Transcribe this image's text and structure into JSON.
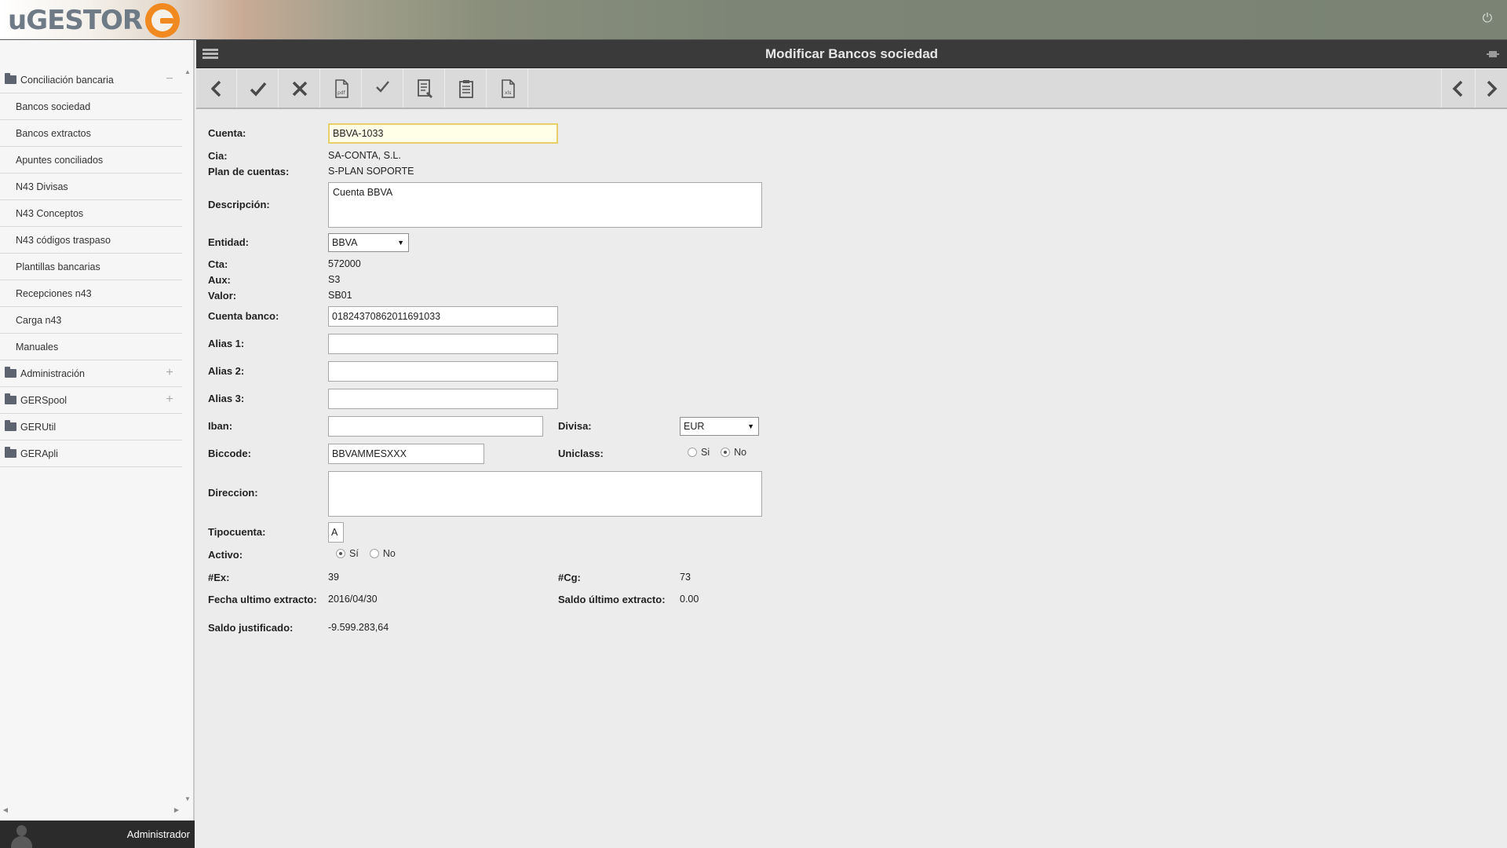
{
  "app": {
    "logo_text": "uGESTOR",
    "page_title": "Modificar Bancos sociedad",
    "user_name": "Administrador"
  },
  "sidebar": {
    "groups": [
      {
        "label": "Conciliación bancaria",
        "toggle": "−"
      },
      {
        "label": "Administración",
        "toggle": "+"
      },
      {
        "label": "GERSpool",
        "toggle": "+"
      },
      {
        "label": "GERUtil",
        "toggle": ""
      },
      {
        "label": "GERApli",
        "toggle": ""
      }
    ],
    "items": [
      "Bancos sociedad",
      "Bancos extractos",
      "Apuntes conciliados",
      "N43 Divisas",
      "N43 Conceptos",
      "N43 códigos traspaso",
      "Plantillas bancarias",
      "Recepciones n43",
      "Carga n43",
      "Manuales"
    ]
  },
  "toolbar": {
    "buttons": [
      "back",
      "accept",
      "cancel",
      "pdf",
      "check",
      "document",
      "clipboard",
      "xls"
    ],
    "nav": [
      "previous-record",
      "next-record"
    ]
  },
  "form": {
    "cuenta": {
      "label": "Cuenta:",
      "value": "BBVA-1033"
    },
    "cia": {
      "label": "Cia:",
      "value": "SA-CONTA, S.L."
    },
    "plan": {
      "label": "Plan de cuentas:",
      "value": "S-PLAN SOPORTE"
    },
    "descripcion": {
      "label": "Descripción:",
      "value": "Cuenta BBVA"
    },
    "entidad": {
      "label": "Entidad:",
      "value": "BBVA"
    },
    "cta": {
      "label": "Cta:",
      "value": "572000"
    },
    "aux": {
      "label": "Aux:",
      "value": "S3"
    },
    "valor": {
      "label": "Valor:",
      "value": "SB01"
    },
    "cuenta_banco": {
      "label": "Cuenta banco:",
      "value": "01824370862011691033"
    },
    "alias1": {
      "label": "Alias 1:",
      "value": ""
    },
    "alias2": {
      "label": "Alias 2:",
      "value": ""
    },
    "alias3": {
      "label": "Alias 3:",
      "value": ""
    },
    "iban": {
      "label": "Iban:",
      "value": ""
    },
    "divisa": {
      "label": "Divisa:",
      "value": "EUR"
    },
    "biccode": {
      "label": "Biccode:",
      "value": "BBVAMMESXXX"
    },
    "uniclass": {
      "label": "Uniclass:",
      "options": [
        "Si",
        "No"
      ],
      "selected": "No"
    },
    "direccion": {
      "label": "Direccion:",
      "value": ""
    },
    "tipocuenta": {
      "label": "Tipocuenta:",
      "value": "A"
    },
    "activo": {
      "label": "Activo:",
      "options": [
        "Sí",
        "No"
      ],
      "selected": "Sí"
    },
    "ex": {
      "label": "#Ex:",
      "value": "39"
    },
    "cg": {
      "label": "#Cg:",
      "value": "73"
    },
    "fecha_ultimo": {
      "label": "Fecha ultimo extracto:",
      "value": "2016/04/30"
    },
    "saldo_ultimo": {
      "label": "Saldo último extracto:",
      "value": "0.00"
    },
    "saldo_justificado": {
      "label": "Saldo justificado:",
      "value": "-9.599.283,64"
    }
  }
}
